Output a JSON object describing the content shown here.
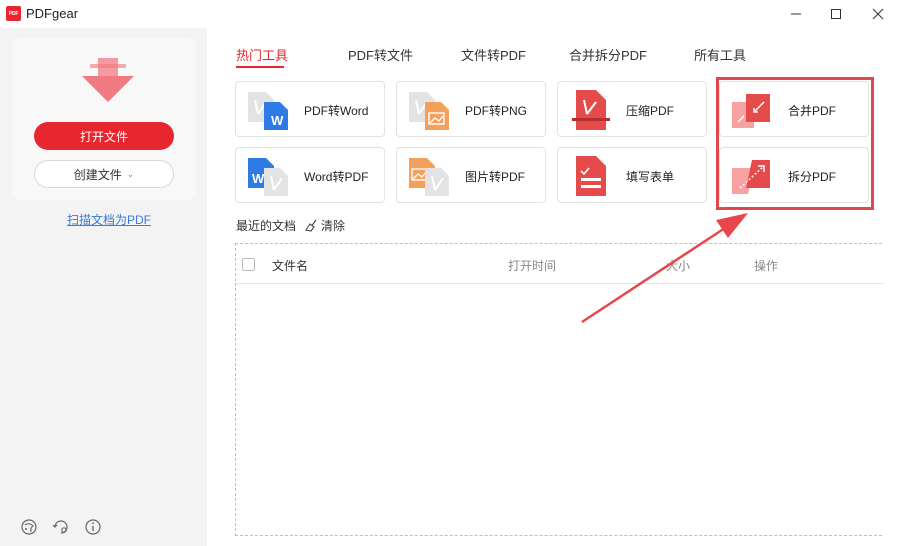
{
  "app": {
    "title": "PDFgear",
    "logo_text": "PDF"
  },
  "sidebar": {
    "open_label": "打开文件",
    "create_label": "创建文件",
    "scan_label": "扫描文档为PDF"
  },
  "tabs": [
    {
      "label": "热门工具",
      "active": true
    },
    {
      "label": "PDF转文件",
      "active": false
    },
    {
      "label": "文件转PDF",
      "active": false
    },
    {
      "label": "合并拆分PDF",
      "active": false
    },
    {
      "label": "所有工具",
      "active": false
    }
  ],
  "tools": [
    {
      "label": "PDF转Word",
      "icon": "pdf-to-word-icon"
    },
    {
      "label": "PDF转PNG",
      "icon": "pdf-to-png-icon"
    },
    {
      "label": "压缩PDF",
      "icon": "compress-pdf-icon"
    },
    {
      "label": "合并PDF",
      "icon": "merge-pdf-icon"
    },
    {
      "label": "Word转PDF",
      "icon": "word-to-pdf-icon"
    },
    {
      "label": "图片转PDF",
      "icon": "image-to-pdf-icon"
    },
    {
      "label": "填写表单",
      "icon": "fill-form-icon"
    },
    {
      "label": "拆分PDF",
      "icon": "split-pdf-icon"
    }
  ],
  "recent": {
    "title": "最近的文档",
    "clear_label": "清除",
    "columns": [
      "文件名",
      "打开时间",
      "大小",
      "操作"
    ],
    "rows": []
  },
  "colors": {
    "accent": "#e8262d",
    "highlight": "#e0464c",
    "link": "#3a7bd5"
  }
}
